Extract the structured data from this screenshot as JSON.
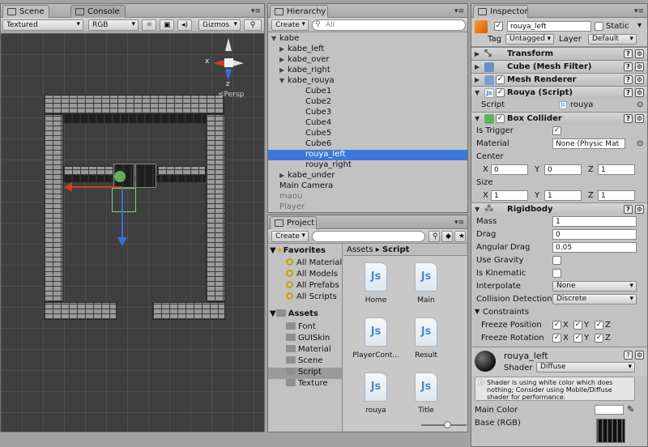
{
  "scene_panel": {
    "tabs": [
      {
        "label": "Scene"
      },
      {
        "label": "Console"
      }
    ],
    "toolbar": {
      "render_mode": "Textured",
      "color_mode": "RGB",
      "gizmos": "Gizmos"
    },
    "gizmo": {
      "x_label": "x",
      "z_label": "z",
      "persp_label": "≤Persp"
    }
  },
  "hierarchy": {
    "tab": "Hierarchy",
    "create_label": "Create",
    "search_placeholder": "All",
    "items": [
      {
        "label": "kabe",
        "arrow": "▼",
        "selected": false,
        "gray": false
      },
      {
        "label": "kabe_left",
        "arrow": "▶",
        "selected": false,
        "gray": false
      },
      {
        "label": "kabe_over",
        "arrow": "▶",
        "selected": false,
        "gray": false
      },
      {
        "label": "kabe_right",
        "arrow": "▶",
        "selected": false,
        "gray": false
      },
      {
        "label": "kabe_rouya",
        "arrow": "▼",
        "selected": false,
        "gray": false
      },
      {
        "label": "Cube1",
        "arrow": "",
        "selected": false,
        "gray": false
      },
      {
        "label": "Cube2",
        "arrow": "",
        "selected": false,
        "gray": false
      },
      {
        "label": "Cube3",
        "arrow": "",
        "selected": false,
        "gray": false
      },
      {
        "label": "Cube4",
        "arrow": "",
        "selected": false,
        "gray": false
      },
      {
        "label": "Cube5",
        "arrow": "",
        "selected": false,
        "gray": false
      },
      {
        "label": "Cube6",
        "arrow": "",
        "selected": false,
        "gray": false
      },
      {
        "label": "rouya_left",
        "arrow": "",
        "selected": true,
        "gray": false
      },
      {
        "label": "rouya_right",
        "arrow": "",
        "selected": false,
        "gray": false
      },
      {
        "label": "kabe_under",
        "arrow": "▶",
        "selected": false,
        "gray": false
      },
      {
        "label": "Main Camera",
        "arrow": "",
        "selected": false,
        "gray": false
      },
      {
        "label": "maou",
        "arrow": "",
        "selected": false,
        "gray": true
      },
      {
        "label": "Player",
        "arrow": "",
        "selected": false,
        "gray": true
      }
    ]
  },
  "project": {
    "tab": "Project",
    "create_label": "Create",
    "favorites_label": "Favorites",
    "favorites": [
      "All Material",
      "All Models",
      "All Prefabs",
      "All Scripts"
    ],
    "assets_label": "Assets",
    "folders": [
      "Font",
      "GUISkin",
      "Material",
      "Scene",
      "Script",
      "Texture"
    ],
    "selected_folder": "Script",
    "breadcrumb": {
      "root": "Assets",
      "sep": "▸",
      "current": "Script"
    },
    "files": [
      {
        "label": "Home",
        "icon": "Js"
      },
      {
        "label": "Main",
        "icon": "Js"
      },
      {
        "label": "PlayerCont...",
        "icon": "Js"
      },
      {
        "label": "Result",
        "icon": "Js"
      },
      {
        "label": "rouya",
        "icon": "Js"
      },
      {
        "label": "Title",
        "icon": "Js"
      }
    ]
  },
  "inspector": {
    "tab": "Inspector",
    "object_name": "rouya_left",
    "static_label": "Static",
    "tag_label": "Tag",
    "tag_value": "Untagged",
    "layer_label": "Layer",
    "layer_value": "Default",
    "components": {
      "transform": "Transform",
      "mesh_filter": "Cube (Mesh Filter)",
      "mesh_renderer": "Mesh Renderer",
      "script": "Rouya (Script)",
      "box_collider": "Box Collider",
      "rigidbody": "Rigidbody"
    },
    "script_field": {
      "label": "Script",
      "value": "rouya"
    },
    "box_collider": {
      "is_trigger_label": "Is Trigger",
      "material_label": "Material",
      "material_value": "None (Physic Mat",
      "center_label": "Center",
      "center": {
        "x": "0",
        "y": "0",
        "z": "1"
      },
      "size_label": "Size",
      "size": {
        "x": "1",
        "y": "1",
        "z": "1"
      },
      "axis": {
        "x": "X",
        "y": "Y",
        "z": "Z"
      }
    },
    "rigidbody": {
      "mass_label": "Mass",
      "mass": "1",
      "drag_label": "Drag",
      "drag": "0",
      "angular_drag_label": "Angular Drag",
      "angular_drag": "0.05",
      "use_gravity_label": "Use Gravity",
      "is_kinematic_label": "Is Kinematic",
      "interpolate_label": "Interpolate",
      "interpolate": "None",
      "collision_label": "Collision Detection",
      "collision": "Discrete",
      "constraints_label": "Constraints",
      "freeze_position_label": "Freeze Position",
      "freeze_rotation_label": "Freeze Rotation"
    },
    "material": {
      "name": "rouya_left",
      "shader_label": "Shader",
      "shader_value": "Diffuse",
      "warning": "Shader is using white color which does nothing; Consider using Mobile/Diffuse shader for performance.",
      "main_color_label": "Main Color",
      "base_label": "Base (RGB)"
    }
  }
}
